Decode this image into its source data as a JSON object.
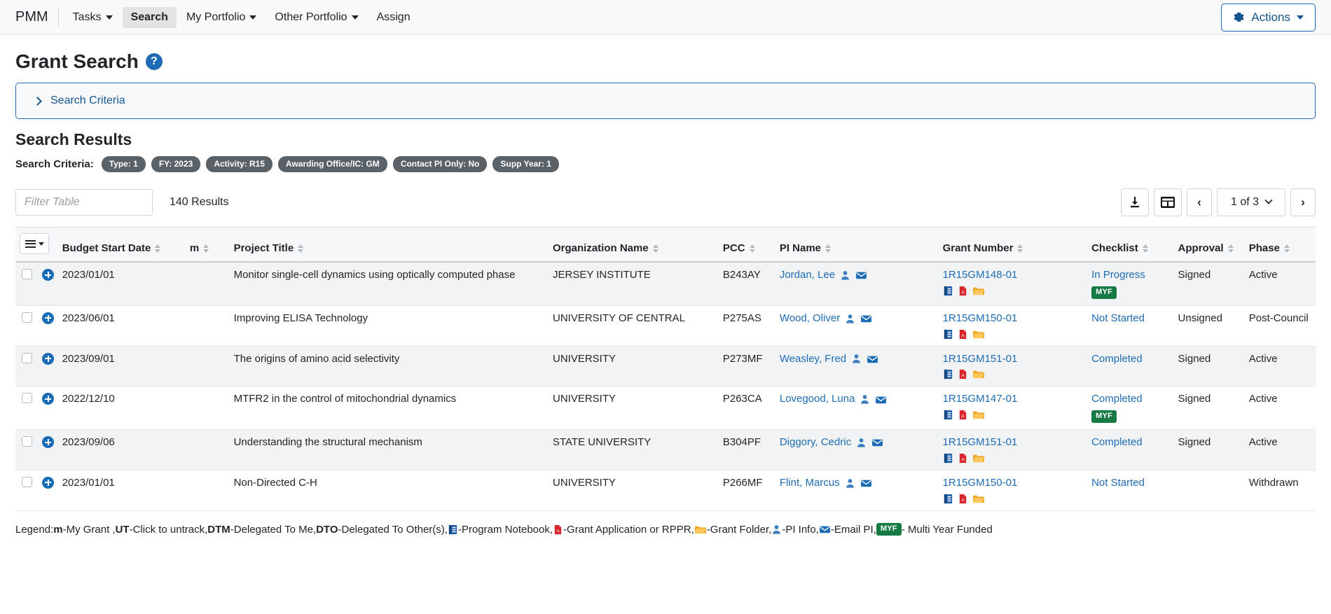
{
  "navbar": {
    "brand": "PMM",
    "items": [
      {
        "label": "Tasks",
        "dropdown": true,
        "active": false
      },
      {
        "label": "Search",
        "dropdown": false,
        "active": true
      },
      {
        "label": "My Portfolio",
        "dropdown": true,
        "active": false
      },
      {
        "label": "Other Portfolio",
        "dropdown": true,
        "active": false
      },
      {
        "label": "Assign",
        "dropdown": false,
        "active": false
      }
    ],
    "actions_label": "Actions",
    "actions_icon": "gear-icon"
  },
  "page": {
    "title": "Grant Search",
    "help_icon": "question-mark-icon",
    "criteria_panel_label": "Search Criteria",
    "results_title": "Search Results",
    "criteria_label": "Search Criteria:",
    "criteria_badges": [
      "Type: 1",
      "FY: 2023",
      "Activity: R15",
      "Awarding Office/IC: GM",
      "Contact PI Only: No",
      "Supp Year: 1"
    ]
  },
  "toolbar": {
    "filter_placeholder": "Filter Table",
    "filter_value": "",
    "results_count": "140 Results",
    "download_icon": "download-icon",
    "columns_icon": "table-layout-icon",
    "prev_label": "‹",
    "next_label": "›",
    "page_indicator": "1 of 3"
  },
  "table": {
    "columns": [
      {
        "label": "Budget Start Date",
        "sortable": true
      },
      {
        "label": "m",
        "sortable": true
      },
      {
        "label": "Project Title",
        "sortable": true
      },
      {
        "label": "Organization Name",
        "sortable": true
      },
      {
        "label": "PCC",
        "sortable": true
      },
      {
        "label": "PI Name",
        "sortable": true
      },
      {
        "label": "Grant Number",
        "sortable": true
      },
      {
        "label": "Checklist",
        "sortable": true
      },
      {
        "label": "Approval",
        "sortable": true
      },
      {
        "label": "Phase",
        "sortable": true
      }
    ],
    "rows": [
      {
        "budget_start_date": "2023/01/01",
        "project_title": "Monitor single-cell dynamics using optically computed phase",
        "organization_name": "JERSEY INSTITUTE",
        "pcc": "B243AY",
        "pi_name": "Jordan, Lee",
        "grant_number": "1R15GM148-01",
        "checklist": "In Progress",
        "myf": "MYF",
        "approval": "Signed",
        "approval_state": "signed",
        "phase": "Active"
      },
      {
        "budget_start_date": "2023/06/01",
        "project_title": "Improving ELISA Technology",
        "organization_name": "UNIVERSITY OF CENTRAL",
        "pcc": "P275AS",
        "pi_name": "Wood, Oliver",
        "grant_number": "1R15GM150-01",
        "checklist": "Not Started",
        "myf": "",
        "approval": "Unsigned",
        "approval_state": "unsigned",
        "phase": "Post-Council"
      },
      {
        "budget_start_date": "2023/09/01",
        "project_title": "The origins of amino acid selectivity",
        "organization_name": "UNIVERSITY",
        "pcc": "P273MF",
        "pi_name": "Weasley, Fred",
        "grant_number": "1R15GM151-01",
        "checklist": "Completed",
        "myf": "",
        "approval": "Signed",
        "approval_state": "signed",
        "phase": "Active"
      },
      {
        "budget_start_date": "2022/12/10",
        "project_title": "MTFR2 in the control of mitochondrial dynamics",
        "organization_name": "UNIVERSITY",
        "pcc": "P263CA",
        "pi_name": "Lovegood, Luna",
        "grant_number": "1R15GM147-01",
        "checklist": "Completed",
        "myf": "MYF",
        "approval": "Signed",
        "approval_state": "signed",
        "phase": "Active"
      },
      {
        "budget_start_date": "2023/09/06",
        "project_title": "Understanding the structural mechanism",
        "organization_name": "STATE UNIVERSITY",
        "pcc": "B304PF",
        "pi_name": "Diggory, Cedric",
        "grant_number": "1R15GM151-01",
        "checklist": "Completed",
        "myf": "",
        "approval": "Signed",
        "approval_state": "signed",
        "phase": "Active"
      },
      {
        "budget_start_date": "2023/01/01",
        "project_title": "Non-Directed C-H",
        "organization_name": "UNIVERSITY",
        "pcc": "P266MF",
        "pi_name": "Flint, Marcus",
        "grant_number": "1R15GM150-01",
        "checklist": "Not Started",
        "myf": "",
        "approval": "",
        "approval_state": "none",
        "phase": "Withdrawn"
      }
    ]
  },
  "legend": {
    "prefix": "Legend: ",
    "parts": [
      {
        "bold": "m",
        "text": "-My Grant , "
      },
      {
        "bold": "UT",
        "text": "-Click to untrack, "
      },
      {
        "bold": "DTM",
        "text": "-Delegated To Me, "
      },
      {
        "bold": "DTO",
        "text": "-Delegated To Other(s), "
      },
      {
        "icon": "program-notebook-icon",
        "text": "-Program Notebook, "
      },
      {
        "icon": "pdf-icon",
        "text": "-Grant Application or RPPR, "
      },
      {
        "icon": "folder-icon",
        "text": "-Grant Folder, "
      },
      {
        "icon": "person-icon",
        "text": "-PI Info, "
      },
      {
        "icon": "envelope-icon",
        "text": "-Email PI, "
      },
      {
        "badge": "MYF",
        "text": " - Multi Year Funded"
      }
    ]
  },
  "colors": {
    "link": "#1d6cb5",
    "signed": "#1f7a3f",
    "unsigned": "#d9342b",
    "myf_badge": "#167a45",
    "criteria_badge": "#5a6268",
    "panel_border": "#2b6cb0"
  }
}
